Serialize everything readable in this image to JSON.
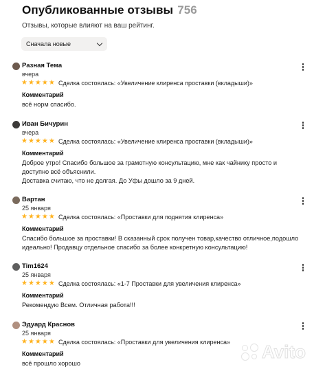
{
  "header": {
    "title": "Опубликованные отзывы",
    "count": "756",
    "subtitle": "Отзывы, которые влияют на ваш рейтинг."
  },
  "sort": {
    "selected": "Сначала новые"
  },
  "reviews": [
    {
      "name": "Разная Тема",
      "date": "вчера",
      "stars": "★★★★★",
      "rating": 5,
      "deal": "Сделка состоялась: «Увеличение клиренса проставки (вкладыши)»",
      "comment_label": "Комментарий",
      "comment": "всё норм спасибо.",
      "avatar_color": "#6d5a4e"
    },
    {
      "name": "Иван Бичурин",
      "date": "вчера",
      "stars": "★★★★★",
      "rating": 5,
      "deal": "Сделка состоялась: «Увеличение клиренса проставки (вкладыши)»",
      "comment_label": "Комментарий",
      "comment": "Доброе утро! Спасибо большое за грамотную консультацию, мне как чайнику просто и доступно всё объяснили.\nДоставка считаю, что не долгая. До Уфы дошло за 9 дней.",
      "avatar_color": "#3c3a38"
    },
    {
      "name": "Вартан",
      "date": "25 января",
      "stars": "★★★★★",
      "rating": 5,
      "deal": "Сделка состоялась: «Проставки для поднятия клиренса»",
      "comment_label": "Комментарий",
      "comment": "Спасибо большое за проставки! В сказанный срок получен товар,качество отличное,подошло идеально! Продавцу отдельное спасибо за более конкретную консультацию!",
      "avatar_color": "#7a6a5c"
    },
    {
      "name": "Tim1624",
      "date": "25 января",
      "stars": "★★★★★",
      "rating": 5,
      "deal": "Сделка состоялась: «1-7 Проставки для увеличения клиренса»",
      "comment_label": "Комментарий",
      "comment": "Рекомендую Всем. Отличная работа!!!",
      "avatar_color": "#5e5e5e"
    },
    {
      "name": "Эдуард Краснов",
      "date": "25 января",
      "stars": "★★★★★",
      "rating": 5,
      "deal": "Сделка состоялась: «Проставки для увеличения клиренса»",
      "comment_label": "Комментарий",
      "comment": "всё прошло хорошо",
      "avatar_color": "#b09080"
    }
  ],
  "watermark": {
    "text": "Avito"
  },
  "colors": {
    "star": "#ffb21e",
    "count": "#9a9a9a",
    "sort_bg": "#f2f1f0"
  }
}
